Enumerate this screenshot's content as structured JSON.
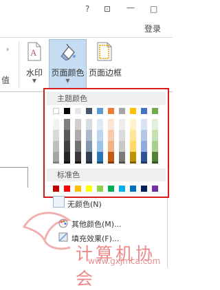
{
  "titlebar": {
    "help": "?",
    "restore": "⊡",
    "minimize": "—",
    "maximize": "□",
    "login": "登录"
  },
  "ribbon": {
    "left_partial": "值",
    "watermark_label": "水印",
    "page_color_label": "页面颜色",
    "page_border_label": "页面边框"
  },
  "dropdown": {
    "theme_colors_header": "主题颜色",
    "standard_colors_header": "标准色",
    "no_color": "无颜色(N)",
    "more_colors": "其他颜色(M)...",
    "fill_effects": "填充效果(F)..."
  },
  "colors": {
    "theme_top": [
      "#ffffff",
      "#000000",
      "#e7e6e6",
      "#44546a",
      "#5b9bd5",
      "#ed7d31",
      "#a5a5a5",
      "#ffc000",
      "#4472c4",
      "#70ad47"
    ],
    "theme_tiles": [
      [
        "#f2f2f2",
        "#d9d9d9",
        "#bfbfbf",
        "#a6a6a6",
        "#808080"
      ],
      [
        "#7f7f7f",
        "#595959",
        "#404040",
        "#262626",
        "#0d0d0d"
      ],
      [
        "#d0cece",
        "#aeabab",
        "#757171",
        "#3a3838",
        "#171616"
      ],
      [
        "#d6dce4",
        "#adb9ca",
        "#8497b0",
        "#323f4f",
        "#222a35"
      ],
      [
        "#deebf6",
        "#bdd7ee",
        "#9dc3e6",
        "#2e75b5",
        "#1f4e79"
      ],
      [
        "#fbe5d5",
        "#f7cbac",
        "#f4b183",
        "#c55a11",
        "#843c0b"
      ],
      [
        "#ededed",
        "#dbdbdb",
        "#c9c9c9",
        "#7b7b7b",
        "#525252"
      ],
      [
        "#fff2cc",
        "#fee599",
        "#ffd965",
        "#bf9000",
        "#7f6000"
      ],
      [
        "#dae3f3",
        "#b4c7e7",
        "#8faadc",
        "#2f5496",
        "#1f3864"
      ],
      [
        "#e2efd9",
        "#c5e0b3",
        "#a8d08d",
        "#538135",
        "#375623"
      ]
    ],
    "standard": [
      "#c00000",
      "#ff0000",
      "#ffc000",
      "#ffff00",
      "#92d050",
      "#00b050",
      "#00b0f0",
      "#0070c0",
      "#002060",
      "#7030a0"
    ],
    "highlight_border": "#d91a1a",
    "active_button": "#c5dcf2"
  },
  "watermark": {
    "cn": "计算机协会",
    "url": "www.gxjmca.com"
  }
}
